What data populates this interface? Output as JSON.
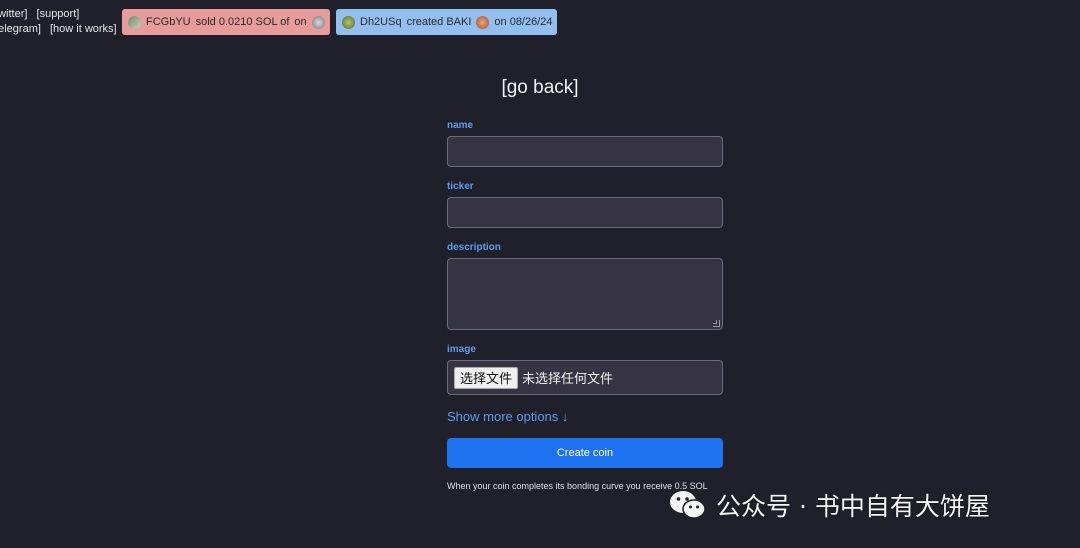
{
  "nav": {
    "row1": [
      "[twitter]",
      "[support]"
    ],
    "row2": [
      "[telegram]",
      "[how it works]"
    ]
  },
  "ticker": {
    "sold": {
      "user": "FCGbYU",
      "text": "sold 0.0210 SOL of",
      "suffix": "on",
      "color": "#e79b9b"
    },
    "created": {
      "user": "Dh2USq",
      "text": "created BAKI",
      "suffix": "on 08/26/24",
      "color": "#93bff0"
    }
  },
  "go_back": "[go back]",
  "form": {
    "name_label": "name",
    "name_value": "",
    "ticker_label": "ticker",
    "ticker_value": "",
    "description_label": "description",
    "description_value": "",
    "image_label": "image",
    "file_button": "选择文件",
    "file_status": "未选择任何文件",
    "more_options": "Show more options ↓",
    "create_button": "Create coin",
    "note": "When your coin completes its bonding curve you receive 0.5 SOL"
  },
  "watermark": {
    "text": "公众号 · 书中自有大饼屋",
    "icon": "wechat-icon"
  },
  "colors": {
    "background": "#1f2029",
    "accent": "#5b9cf0",
    "button": "#1d72f0",
    "input_bg": "#363442"
  }
}
